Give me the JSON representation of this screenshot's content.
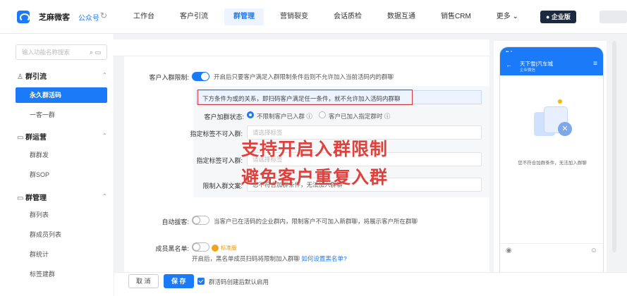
{
  "topbar": {
    "brand": "芝麻微客",
    "account_tag": "公众号",
    "nav": [
      "工作台",
      "客户引流",
      "群管理",
      "营销裂变",
      "会话质检",
      "数据互通",
      "销售CRM",
      "更多 ⌄"
    ],
    "active_nav": "群管理",
    "enterprise_badge": "● 企业版"
  },
  "sidebar": {
    "search_placeholder": "输入功能名称搜索",
    "groups": [
      {
        "title": "群引流",
        "icon": "users-icon",
        "items": [
          "永久群活码",
          "一客一群"
        ]
      },
      {
        "title": "群运营",
        "icon": "chat-icon",
        "items": [
          "群群发",
          "群SOP"
        ]
      },
      {
        "title": "群管理",
        "icon": "chat-icon",
        "items": [
          "群列表",
          "群成员列表",
          "群统计",
          "标签建群"
        ]
      }
    ],
    "active_item": "永久群活码"
  },
  "form": {
    "entry_limit_label": "客户入群限制:",
    "entry_limit_desc": "开启后只要客户满足入群限制条件后则不允许加入当前活码内的群聊",
    "notice": "下方条件为或的关系，即扫码客户满足任一条件，就不允许加入活码内群聊",
    "status_label": "客户加群状态:",
    "status_option1": "不限制客户已入群 ⓘ",
    "status_option2": "客户已加入指定群时 ⓘ",
    "tag_forbid_label": "指定标签不可入群:",
    "tag_forbid_placeholder": "请选择标签",
    "tag_allow_label": "指定标签可入群:",
    "tag_allow_placeholder": "请选择标签",
    "limit_text_label": "限制入群文案:",
    "limit_text_value": "您不符合加群条件，无法加入群聊",
    "auto_kick_label": "自动拔客:",
    "auto_kick_desc": "当客户已在活码的企业群内，限制客户不可加入新群聊，将展示客户所在群聊",
    "blacklist_label": "成员黑名单:",
    "blacklist_badge": "标准版",
    "blacklist_desc": "开启后，黑名单成员扫码将限制加入群聊",
    "blacklist_link": "如何设置黑名单?"
  },
  "overlay": {
    "line1": "支持开启入群限制",
    "line2": "避免客户重复入群"
  },
  "bottom": {
    "cancel": "取 消",
    "save": "保 存",
    "checkbox_label": "群活码创建后默认启用"
  },
  "phone": {
    "title": "天下雪|汽车城",
    "subtitle": "企业微信",
    "message": "您不符合加群条件，无法加入群聊"
  }
}
